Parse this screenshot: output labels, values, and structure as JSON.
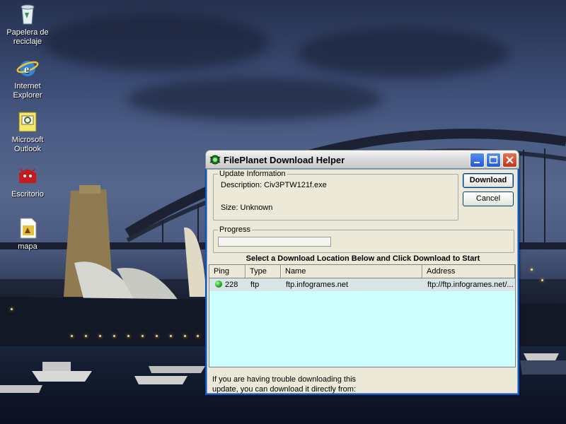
{
  "desktop": {
    "icons": [
      {
        "label": "Papelera de reciclaje",
        "icon": "recycle-bin-icon"
      },
      {
        "label": "Internet Explorer",
        "icon": "internet-explorer-icon"
      },
      {
        "label": "Microsoft Outlook",
        "icon": "outlook-icon"
      },
      {
        "label": "Escritorio",
        "icon": "desktop-folder-icon"
      },
      {
        "label": "mapa",
        "icon": "gif-file-icon"
      }
    ]
  },
  "window": {
    "title": "FilePlanet Download Helper",
    "update_info": {
      "legend": "Update Information",
      "description": "Description: Civ3PTW121f.exe",
      "size": "Size: Unknown"
    },
    "buttons": {
      "download": "Download",
      "cancel": "Cancel"
    },
    "progress": {
      "legend": "Progress",
      "value": 0
    },
    "instruction": "Select a Download Location Below and Click Download to Start",
    "table": {
      "columns": [
        "Ping",
        "Type",
        "Name",
        "Address"
      ],
      "rows": [
        {
          "ping": "228",
          "type": "ftp",
          "name": "ftp.infogrames.net",
          "address": "ftp://ftp.infogrames.net/...",
          "status_color": "#1aa31a"
        }
      ]
    },
    "footer": {
      "line1": "If you are having trouble downloading this",
      "line2": "update, you can download it directly from:"
    }
  }
}
